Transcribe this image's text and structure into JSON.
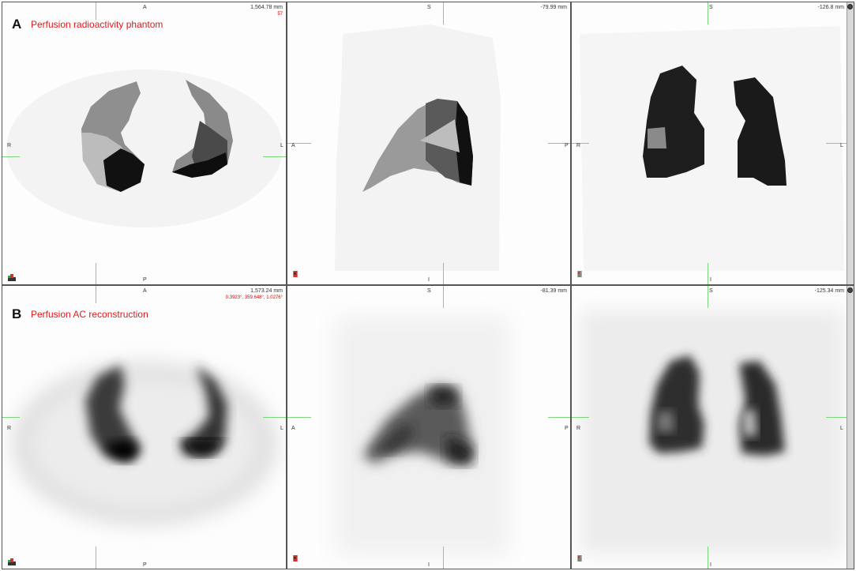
{
  "panels": {
    "a": {
      "letter": "A",
      "title": "Perfusion radioactivity phantom",
      "axial": {
        "top": "A",
        "bottom": "P",
        "left": "R",
        "right": "L",
        "mm": "1,564.78 mm",
        "slice": "57"
      },
      "sagittal": {
        "top": "S",
        "bottom": "I",
        "left": "A",
        "right": "P",
        "mm": "-79.99 mm"
      },
      "coronal": {
        "top": "S",
        "bottom": "I",
        "left": "R",
        "right": "L",
        "mm": "-126.8 mm"
      }
    },
    "b": {
      "letter": "B",
      "title": "Perfusion  AC reconstruction",
      "axial": {
        "top": "A",
        "bottom": "P",
        "left": "R",
        "right": "L",
        "mm": "1,573.24 mm",
        "angles": "0.3923°, 359.648°, 1.0276°"
      },
      "sagittal": {
        "top": "S",
        "bottom": "I",
        "left": "A",
        "right": "P",
        "mm": "-81.39 mm"
      },
      "coronal": {
        "top": "S",
        "bottom": "I",
        "left": "R",
        "right": "L",
        "mm": "-125.34 mm"
      }
    }
  },
  "colors": {
    "crosshair": "#7bd67b",
    "annotation_red": "#e0191b"
  },
  "icons": [
    "orientation-cube-icon",
    "scroll-knob-icon"
  ]
}
